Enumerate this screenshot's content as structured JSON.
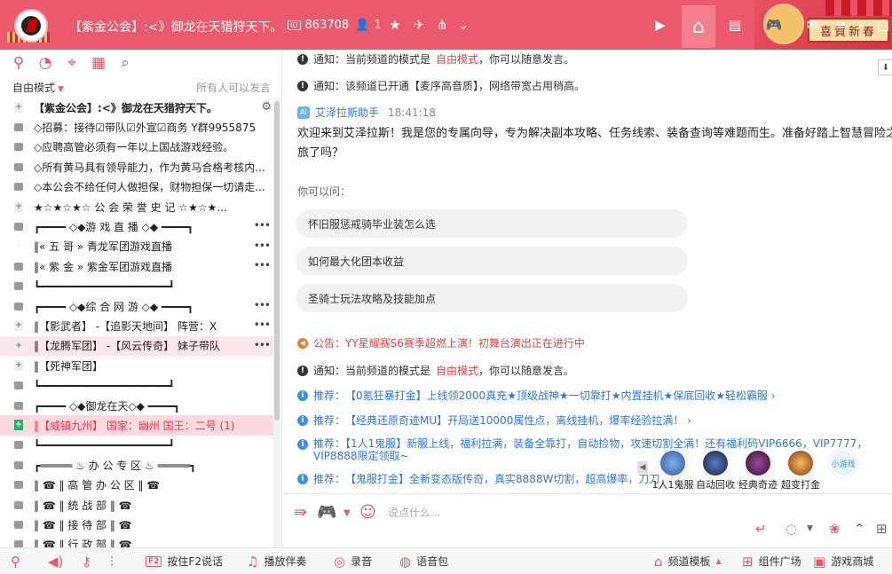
{
  "titlebar": {
    "channel_title": "【紫金公会】:<》御龙在天猎狩天下。",
    "channel_id": "863708",
    "online_count": "1",
    "banner_text": "喜賀新春"
  },
  "sidebar": {
    "mode_label": "自由模式",
    "speak_permission": "所有人可以发言",
    "channels": [
      {
        "name": "【紫金公会】:<》御龙在天猎狩天下。",
        "marker": "plus",
        "bold": true,
        "robot": true
      },
      {
        "name": "◇招募：接待☑带队☑外宣☑商务 Y群9955875",
        "marker": "lock"
      },
      {
        "name": "◇应聘高管必须有一年以上国战游戏经验。",
        "marker": "lock"
      },
      {
        "name": "◇所有黄马具有领导能力，作为黄马合格考核内...",
        "marker": "lock"
      },
      {
        "name": "◇本公会不给任何人做担保，财物担保一切请走...",
        "marker": "lock"
      },
      {
        "name": "★☆★☆★☆  公 会 荣 誉 史 记  ☆★☆★...",
        "marker": "plus"
      },
      {
        "name": "┏━━━━ ◇◆游 戏 直 播 ◇◆ ━━━━┓",
        "marker": "lock",
        "more": true
      },
      {
        "name": "‖«  五   哥  »        青龙军团游戏直播",
        "marker": "dot",
        "more": true
      },
      {
        "name": "‖«  紫   金  »        紫金军团游戏直播",
        "marker": "lock",
        "more": true
      },
      {
        "name": "┗━━━━━━━━━━━━━━━━━━━━┛",
        "marker": "lock"
      },
      {
        "name": "┏━━━━ ◇◆综 合 网 游 ◇◆ ━━━━┓",
        "marker": "lock",
        "more": true
      },
      {
        "name": "‖【影武者】    -【追影天地间】      阵营：X",
        "marker": "plus",
        "more": true
      },
      {
        "name": "‖【龙腾军团】  -【风云传奇】  妹子带队",
        "marker": "plus",
        "more": true,
        "highlight": true
      },
      {
        "name": "‖【死神军团】",
        "marker": "plus"
      },
      {
        "name": "┗━━━━━━━━━━━━━━━━━━━━┛",
        "marker": "lock"
      },
      {
        "name": "┏━━━━ ◇◆御龙在天◇◆ ━━━━┓",
        "marker": "lock"
      },
      {
        "name": "‖【威镇九州】   国家：幽州    国王：二号 (1)",
        "marker": "current",
        "current": true
      },
      {
        "name": "┗━━━━━━━━━━━━━━━━━━━━┛",
        "marker": "lock"
      },
      {
        "name": "┏═════  ♨  办 公 专 区  ♨  ═════┓",
        "marker": "lock"
      },
      {
        "name": "‖  ☎  ‖        高 管 办 公 区           ‖  ☎",
        "marker": "lock"
      },
      {
        "name": "‖  ☎  ‖        统     战     部           ‖  ☎",
        "marker": "lock"
      },
      {
        "name": "‖  ☎  ‖        接     待     部           ‖  ☎",
        "marker": "lock"
      },
      {
        "name": "‖  ☎  ‖        行     政     部           ‖  ☎",
        "marker": "lock"
      }
    ]
  },
  "chat": {
    "notice1_label": "通知：",
    "notice1_text_a": "当前频道的模式是",
    "notice1_mode": "自由模式",
    "notice1_text_b": "，你可以随意发言。",
    "notice2_label": "通知：",
    "notice2_text": "该频道已开通【麦序高音质】，网络带宽占用稍高。",
    "bot_name": "艾泽拉斯助手",
    "bot_time": "18:41:18",
    "welcome": "欢迎来到艾泽拉斯！我是您的专属向导，专为解决副本攻略、任务线索、装备查询等难题而生。准备好踏上智慧冒险之旅了吗？",
    "ask_label": "你可以问：",
    "suggestions": [
      "怀旧服惩戒骑毕业装怎么选",
      "如何最大化团本收益",
      "圣骑士玩法攻略及技能加点"
    ],
    "announcement": "公告：YY星耀赛S6赛季超燃上演！初舞台演出正在进行中",
    "notice3_label": "通知：",
    "notice3_text_a": "当前频道的模式是",
    "notice3_mode": "自由模式",
    "notice3_text_b": "，你可以随意发言。",
    "promo_label": "推荐：",
    "promos": [
      "【0氪狂暴打金】上线领2000真充★顶级战神★一切靠打★内置挂机★保底回收★轻松霸服 ›",
      "【经典还原奇迹MU】开局送10000属性点，离线挂机，爆率经验拉满！ ›",
      "【1人1鬼服】新服上线，福利拉满，装备全靠打，自动捡物，攻速切割全满！还有福利码VIP6666，VIP7777，VIP8888限定领取~",
      "【鬼服打金】全新变态版传奇，真实8888W切割，超高爆率，刀刀"
    ]
  },
  "games": [
    {
      "label": "1人1鬼服",
      "color": "#3a6fb5"
    },
    {
      "label": "自动回收",
      "color": "#2a3a6a"
    },
    {
      "label": "经典奇迹",
      "color": "#5a2a5a"
    },
    {
      "label": "超变打金",
      "color": "#c8892a"
    },
    {
      "label": "小游戏",
      "color": "#8fd0f0"
    }
  ],
  "input": {
    "placeholder": "说点什么..."
  },
  "bottombar": {
    "f2_key": "F2",
    "push_to_talk": "按住F2说话",
    "play_music": "播放伴奏",
    "record": "录音",
    "voice_pack": "语音包",
    "channel_template": "频道模板",
    "widget_square": "组件广场",
    "game_mall": "游戏商城"
  }
}
